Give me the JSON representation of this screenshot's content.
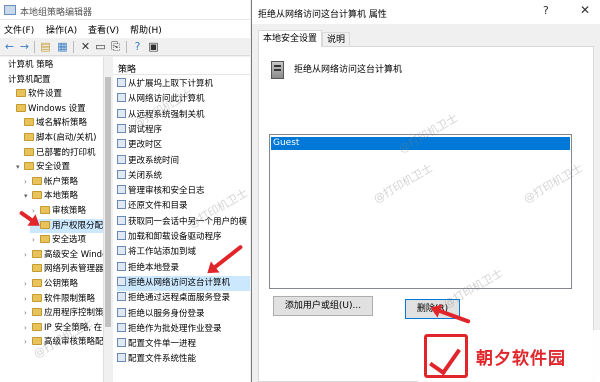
{
  "gpedit": {
    "title": "本地组策略编辑器",
    "menu": [
      "文件(F)",
      "操作(A)",
      "查看(V)",
      "帮助(H)"
    ],
    "tree": [
      {
        "label": "计算机 策略",
        "level": 0,
        "exp": "",
        "icon": "none"
      },
      {
        "label": "计算机配置",
        "level": 0,
        "exp": "",
        "icon": "none"
      },
      {
        "label": "软件设置",
        "level": 1,
        "exp": "",
        "icon": "folder"
      },
      {
        "label": "Windows 设置",
        "level": 1,
        "exp": "",
        "icon": "folder"
      },
      {
        "label": "域名解析策略",
        "level": 2,
        "exp": "",
        "icon": "folder"
      },
      {
        "label": "脚本(启动/关机)",
        "level": 2,
        "exp": "",
        "icon": "folder"
      },
      {
        "label": "已部署的打印机",
        "level": 2,
        "exp": "",
        "icon": "folder"
      },
      {
        "label": "安全设置",
        "level": 2,
        "exp": "▾",
        "icon": "folder"
      },
      {
        "label": "帐户策略",
        "level": 3,
        "exp": "›",
        "icon": "folder"
      },
      {
        "label": "本地策略",
        "level": 3,
        "exp": "▾",
        "icon": "folder"
      },
      {
        "label": "审核策略",
        "level": 4,
        "exp": "›",
        "icon": "folder"
      },
      {
        "label": "用户权限分配",
        "level": 4,
        "exp": "",
        "icon": "folder",
        "selected": true
      },
      {
        "label": "安全选项",
        "level": 4,
        "exp": "›",
        "icon": "folder"
      },
      {
        "label": "高级安全 Windo",
        "level": 3,
        "exp": "›",
        "icon": "folder"
      },
      {
        "label": "网络列表管理器",
        "level": 3,
        "exp": "",
        "icon": "folder"
      },
      {
        "label": "公钥策略",
        "level": 3,
        "exp": "›",
        "icon": "folder"
      },
      {
        "label": "软件限制策略",
        "level": 3,
        "exp": "›",
        "icon": "folder"
      },
      {
        "label": "应用程序控制策",
        "level": 3,
        "exp": "›",
        "icon": "folder"
      },
      {
        "label": "IP 安全策略, 在",
        "level": 3,
        "exp": "›",
        "icon": "folder"
      },
      {
        "label": "高级审核策略配",
        "level": 3,
        "exp": "›",
        "icon": "folder"
      }
    ],
    "list_header": "策略",
    "policies": [
      "从扩展坞上取下计算机",
      "从网络访问此计算机",
      "从远程系统强制关机",
      "调试程序",
      "更改时区",
      "更改系统时间",
      "关闭系统",
      "管理审核和安全日志",
      "还原文件和目录",
      "获取同一会话中另一个用户的模",
      "加载和卸载设备驱动程序",
      "将工作站添加到域",
      "拒绝本地登录",
      "拒绝从网络访问这台计算机",
      "拒绝通过远程桌面服务登录",
      "拒绝以服务身份登录",
      "拒绝作为批处理作业登录",
      "配置文件单一进程",
      "配置文件系统性能"
    ],
    "selected_policy_index": 13
  },
  "dialog": {
    "title": "拒绝从网络访问这台计算机 属性",
    "help": "?",
    "close": "✕",
    "tabs": [
      "本地安全设置",
      "说明"
    ],
    "policy_name": "拒绝从网络访问这台计算机",
    "users": [
      "Guest"
    ],
    "add_button": "添加用户或组(U)...",
    "remove_button": "删除(R)"
  },
  "watermark": "@打印机卫士",
  "brand": {
    "name": "朝夕软件园",
    "accent": "#e0262b"
  }
}
